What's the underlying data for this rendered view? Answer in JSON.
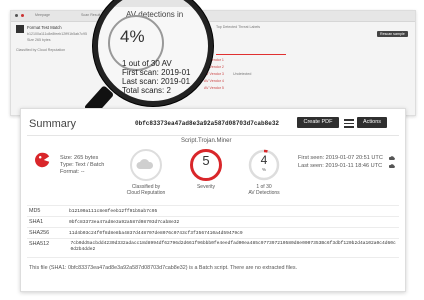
{
  "top_screenshot": {
    "tabs": [
      "Meepage",
      "Scan Result",
      "Overview"
    ],
    "title": "Format Test Match",
    "meta_line_1": "b12100a111c8e8feeb12ff91b5ab7c95",
    "meta_line_2": "Size 265 bytes",
    "meta_line_3": "Classified by Cloud Reputation",
    "right_header": "Top Detected Threat Labels",
    "action_button": "Rescan sample",
    "av_rows": [
      "AV Vendor 1",
      "AV Vendor 2",
      "AV Vendor 3",
      "AV Vendor 4",
      "AV Vendor 5"
    ],
    "av_status": "Undetected"
  },
  "magnifier": {
    "title": "AV detections in",
    "percent": "4%",
    "line1": "1 out of 30 AV",
    "line2": "First scan: 2019-01",
    "line3": "Last scan: 2019-01",
    "line4": "Total scans: 2"
  },
  "summary": {
    "title": "Summary",
    "hash": "0bfc83373ea47ad8e3a92a587d08703d7cab8e32",
    "create_pdf": "Create PDF",
    "actions": "Actions",
    "malware_name": "Script.Trojan.Miner",
    "size": "Size: 265 bytes",
    "type": "Type: Text / Batch",
    "format": "Format: --",
    "classified_label_1": "Classified by",
    "classified_label_2": "Cloud Reputation",
    "severity_value": "5",
    "severity_label": "Severity",
    "av_value": "4",
    "av_unit": "%",
    "av_label_1": "1 of 30",
    "av_label_2": "AV Detections",
    "first_seen": "First seen: 2019-01-07 20:51 UTC",
    "last_seen": "Last seen: 2019-01-11 18:46 UTC",
    "hashes": [
      {
        "key": "MD5",
        "value": "b12100a111c8e8feeb12ff91b5ab7c95"
      },
      {
        "key": "SHA1",
        "value": "0bfc83373ea47ad8e3a92a587d08703d7cab8e32"
      },
      {
        "key": "SHA256",
        "value": "11d4b03c24f0f8d8e8ba4837d448707de8076c0743cf3f3567410a4d59479c9"
      },
      {
        "key": "SHA512",
        "value": "7cb0dd5acbdd4230d332adacc18d8994df62796d2d661f96bbb0fe4eedfad00ea485c977397210580d8e0007353Bc6f3dbf120b2d4a102a0c4d60c0d2b4dde2"
      }
    ],
    "footer": "This file (SHA1: 0bfc83373ea47ad8e3a92a587d08703d7cab8e32) is a Batch script. There are no extracted files."
  },
  "colors": {
    "severity_ring": "#d9262a",
    "av_ring_bg": "#dddddd",
    "av_ring_fg": "#d9262a",
    "avatar_red": "#d9262a",
    "button_dark": "#2f2f2f"
  },
  "av_detection_fraction": 0.04
}
